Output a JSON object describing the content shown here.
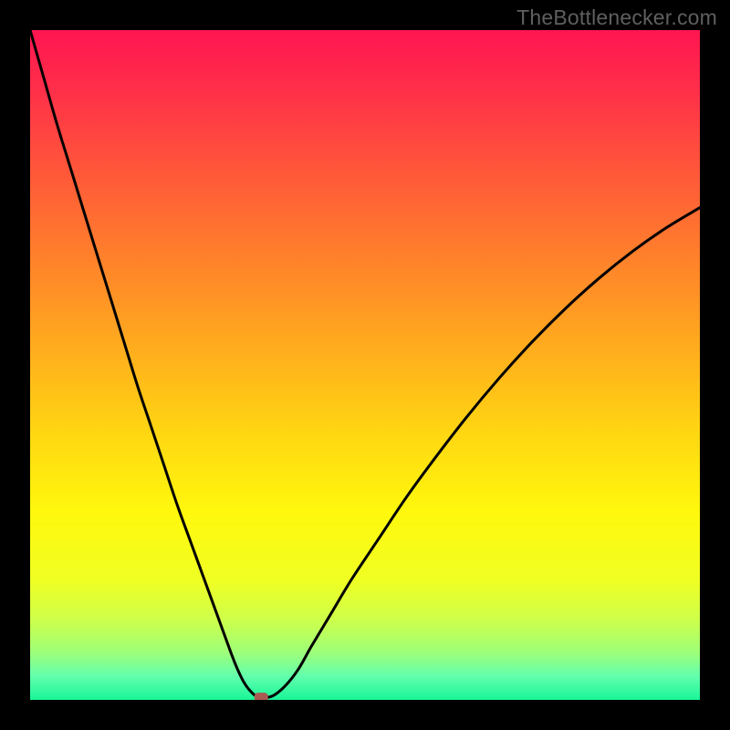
{
  "watermark": "TheBottlenecker.com",
  "colors": {
    "frame": "#000000",
    "curve": "#000000",
    "marker": "#aa5a52",
    "gradient_stops": [
      {
        "offset": 0.0,
        "color": "#ff1551"
      },
      {
        "offset": 0.09,
        "color": "#ff2f49"
      },
      {
        "offset": 0.22,
        "color": "#ff5a38"
      },
      {
        "offset": 0.35,
        "color": "#ff842a"
      },
      {
        "offset": 0.48,
        "color": "#ffae1d"
      },
      {
        "offset": 0.6,
        "color": "#ffd612"
      },
      {
        "offset": 0.72,
        "color": "#fff80d"
      },
      {
        "offset": 0.82,
        "color": "#f0ff23"
      },
      {
        "offset": 0.88,
        "color": "#ceff4a"
      },
      {
        "offset": 0.93,
        "color": "#9dff7a"
      },
      {
        "offset": 0.965,
        "color": "#62ffad"
      },
      {
        "offset": 1.0,
        "color": "#18f598"
      }
    ]
  },
  "chart_data": {
    "type": "line",
    "title": "",
    "xlabel": "",
    "ylabel": "",
    "xlim": [
      0,
      100
    ],
    "ylim": [
      0,
      100
    ],
    "grid": false,
    "legend": false,
    "series": [
      {
        "name": "bottleneck-curve",
        "x": [
          0,
          2,
          4,
          6,
          8,
          10,
          12,
          14,
          16,
          18,
          20,
          22,
          24,
          26,
          28,
          30,
          31,
          32,
          33,
          34,
          36,
          38,
          40,
          42,
          45,
          48,
          52,
          56,
          60,
          65,
          70,
          75,
          80,
          85,
          90,
          95,
          100
        ],
        "y": [
          100,
          93,
          86,
          79.5,
          73,
          66.5,
          60,
          53.5,
          47,
          41,
          35,
          29,
          23.5,
          18,
          12.5,
          7,
          4.5,
          2.5,
          1.2,
          0.5,
          0.5,
          2,
          4.5,
          8,
          13,
          18,
          24,
          30,
          35.5,
          42,
          48,
          53.5,
          58.5,
          63,
          67,
          70.5,
          73.5
        ]
      }
    ],
    "marker": {
      "x": 34.5,
      "y": 0.4
    },
    "notes": "V-shaped bottleneck curve over vertical rainbow gradient; minimum near x≈34."
  }
}
